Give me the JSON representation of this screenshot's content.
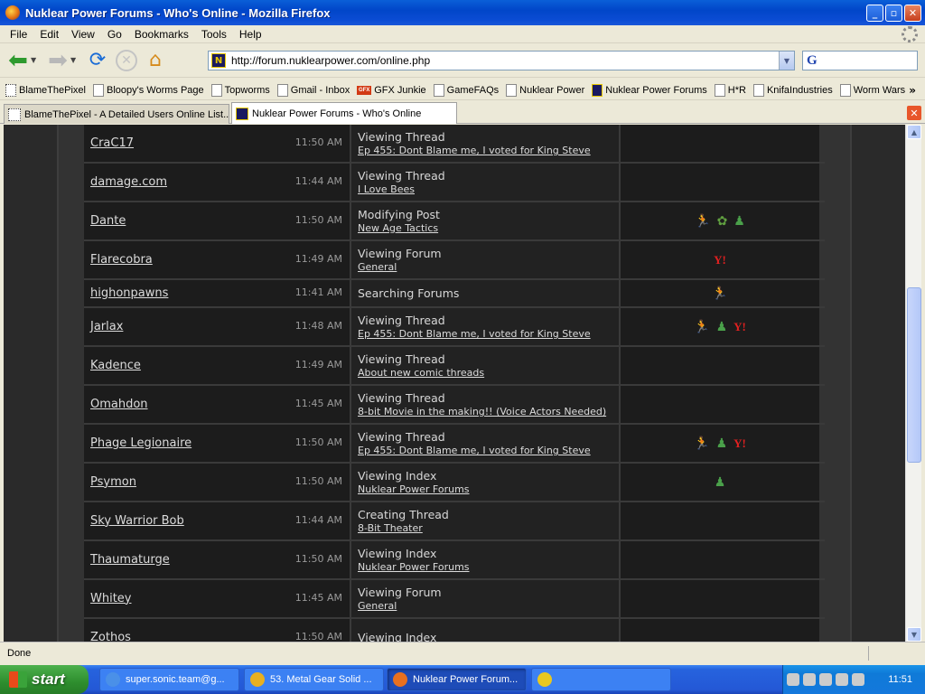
{
  "window": {
    "title": "Nuklear Power Forums - Who's Online - Mozilla Firefox"
  },
  "menu": [
    "File",
    "Edit",
    "View",
    "Go",
    "Bookmarks",
    "Tools",
    "Help"
  ],
  "nav": {
    "url": "http://forum.nuklearpower.com/online.php"
  },
  "bookmarks": [
    {
      "label": "BlameThePixel",
      "icon": "btp"
    },
    {
      "label": "Bloopy's Worms Page",
      "icon": "page"
    },
    {
      "label": "Topworms",
      "icon": "page"
    },
    {
      "label": "Gmail - Inbox",
      "icon": "page"
    },
    {
      "label": "GFX Junkie",
      "icon": "gfx"
    },
    {
      "label": "GameFAQs",
      "icon": "page"
    },
    {
      "label": "Nuklear Power",
      "icon": "page"
    },
    {
      "label": "Nuklear Power Forums",
      "icon": "np"
    },
    {
      "label": "H*R",
      "icon": "page"
    },
    {
      "label": "KnifaIndustries",
      "icon": "page"
    },
    {
      "label": "Worm Wars",
      "icon": "page"
    }
  ],
  "tabs": [
    {
      "label": "BlameThePixel - A Detailed Users Online List...",
      "icon": "btp",
      "active": false
    },
    {
      "label": "Nuklear Power Forums - Who's Online",
      "icon": "np",
      "active": true
    }
  ],
  "online_users": [
    {
      "name": "CraC17",
      "time": "11:50 AM",
      "action": "Viewing Thread",
      "link": "Ep 455: Dont Blame me, I voted for King Steve",
      "icons": []
    },
    {
      "name": "damage.com",
      "time": "11:44 AM",
      "action": "Viewing Thread",
      "link": "I Love Bees",
      "icons": []
    },
    {
      "name": "Dante",
      "time": "11:50 AM",
      "action": "Modifying Post",
      "link": "New Age Tactics",
      "icons": [
        "aim",
        "icq",
        "msn"
      ]
    },
    {
      "name": "Flarecobra",
      "time": "11:49 AM",
      "action": "Viewing Forum",
      "link": "General",
      "icons": [
        "yahoo"
      ]
    },
    {
      "name": "highonpawns",
      "time": "11:41 AM",
      "action": "Searching Forums",
      "link": "",
      "icons": [
        "aim"
      ]
    },
    {
      "name": "Jarlax",
      "time": "11:48 AM",
      "action": "Viewing Thread",
      "link": "Ep 455: Dont Blame me, I voted for King Steve",
      "icons": [
        "aim",
        "msn",
        "yahoo"
      ]
    },
    {
      "name": "Kadence",
      "time": "11:49 AM",
      "action": "Viewing Thread",
      "link": "About new comic threads",
      "icons": []
    },
    {
      "name": "Omahdon",
      "time": "11:45 AM",
      "action": "Viewing Thread",
      "link": "8-bit Movie in the making!! (Voice Actors Needed)",
      "icons": []
    },
    {
      "name": "Phage Legionaire",
      "time": "11:50 AM",
      "action": "Viewing Thread",
      "link": "Ep 455: Dont Blame me, I voted for King Steve",
      "icons": [
        "aim",
        "msn",
        "yahoo"
      ]
    },
    {
      "name": "Psymon",
      "time": "11:50 AM",
      "action": "Viewing Index",
      "link": "Nuklear Power Forums",
      "icons": [
        "msn"
      ]
    },
    {
      "name": "Sky Warrior Bob",
      "time": "11:44 AM",
      "action": "Creating Thread",
      "link": "8-Bit Theater",
      "icons": []
    },
    {
      "name": "Thaumaturge",
      "time": "11:50 AM",
      "action": "Viewing Index",
      "link": "Nuklear Power Forums",
      "icons": []
    },
    {
      "name": "Whitey",
      "time": "11:45 AM",
      "action": "Viewing Forum",
      "link": "General",
      "icons": []
    },
    {
      "name": "Zothos",
      "time": "11:50 AM",
      "action": "Viewing Index",
      "link": "",
      "icons": []
    }
  ],
  "status": {
    "text": "Done"
  },
  "taskbar": {
    "start_label": "start",
    "tasks": [
      {
        "label": "super.sonic.team@g...",
        "active": false,
        "color": "#4a90e8"
      },
      {
        "label": "53. Metal Gear Solid ...",
        "active": false,
        "color": "#e8b020"
      },
      {
        "label": "Nuklear Power Forum...",
        "active": true,
        "color": "#e87020"
      },
      {
        "label": "",
        "active": false,
        "color": "#e8c820"
      }
    ],
    "clock": "11:51"
  },
  "colors": {
    "title_blue": "#0146c9",
    "forum_bg": "#1c1c1c",
    "link_text": "#dcdcdc",
    "yahoo_red": "#e02020"
  }
}
